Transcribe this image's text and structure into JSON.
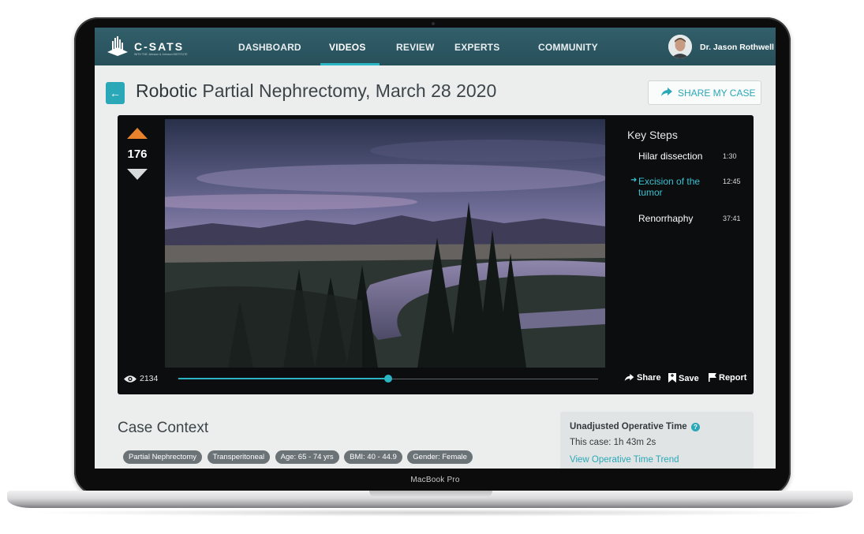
{
  "device": {
    "label": "MacBook Pro"
  },
  "nav": {
    "logo_text": "C-SATS",
    "logo_subtext": "WITH THE Johnson & Johnson INSTITUTE",
    "items": [
      {
        "label": "DASHBOARD",
        "active": false
      },
      {
        "label": "VIDEOS",
        "active": true
      },
      {
        "label": "REVIEW",
        "active": false
      },
      {
        "label": "EXPERTS",
        "active": false
      },
      {
        "label": "COMMUNITY",
        "active": false
      }
    ],
    "user_name": "Dr. Jason Rothwell"
  },
  "page": {
    "title_strong": "Robotic",
    "title_rest": " Partial Nephrectomy, March 28 2020",
    "share_case_label": "SHARE MY CASE"
  },
  "player": {
    "votes": "176",
    "views": "2134",
    "progress_fraction": 0.5,
    "key_steps_title": "Key Steps",
    "key_steps": [
      {
        "name": "Hilar dissection",
        "time": "1:30",
        "active": false
      },
      {
        "name": "Excision of the tumor",
        "time": "12:45",
        "active": true
      },
      {
        "name": "Renorrhaphy",
        "time": "37:41",
        "active": false
      }
    ],
    "actions": {
      "share": "Share",
      "save": "Save",
      "report": "Report"
    }
  },
  "case_context": {
    "title": "Case Context",
    "tags": [
      "Partial Nephrectomy",
      "Transperitoneal",
      "Age: 65 - 74 yrs",
      "BMI: 40 - 44.9",
      "Gender: Female"
    ]
  },
  "operative_time": {
    "title": "Unadjusted Operative Time",
    "value": "This case: 1h 43m 2s",
    "link": "View Operative Time Trend"
  },
  "colors": {
    "nav_bg": "#2c5964",
    "accent": "#2bb5c4",
    "upvote": "#e8822c"
  }
}
